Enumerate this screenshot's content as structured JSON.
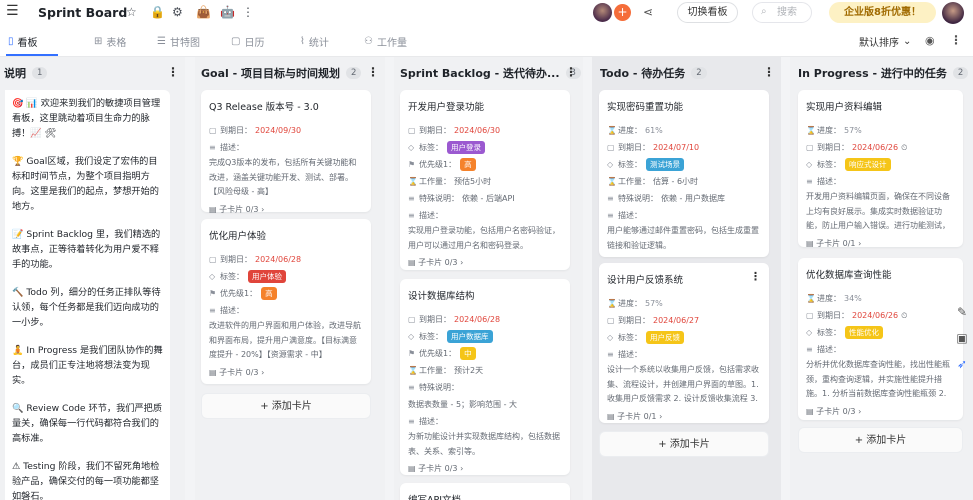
{
  "app": {
    "title": "Sprint Board",
    "switch_board": "切换看板",
    "search_placeholder": "搜索",
    "promo": "企业版8折优惠！"
  },
  "tabs": [
    {
      "label": "看板",
      "icon": "board-icon"
    },
    {
      "label": "表格",
      "icon": "table-icon"
    },
    {
      "label": "甘特图",
      "icon": "gantt-icon"
    },
    {
      "label": "日历",
      "icon": "calendar-icon"
    },
    {
      "label": "统计",
      "icon": "stats-icon"
    },
    {
      "label": "工作量",
      "icon": "workload-icon"
    }
  ],
  "sort_label": "默认排序",
  "columns": [
    {
      "title": "说明",
      "count": "1"
    },
    {
      "title": "Goal - 项目目标与时间规划",
      "count": "2"
    },
    {
      "title": "Sprint Backlog - 迭代待办...",
      "count": "3"
    },
    {
      "title": "Todo - 待办任务",
      "count": "2"
    },
    {
      "title": "In Progress - 进行中的任务",
      "count": "2"
    }
  ],
  "intro_paragraphs": [
    "🎯 📊 欢迎来到我们的敏捷项目管理看板，这里跳动着项目生命力的脉搏！📈 🛠",
    "🏆 Goal区域，我们设定了宏伟的目标和时间节点，为整个项目指明方向。这里是我们的起点，梦想开始的地方。",
    "📝 Sprint Backlog 里，我们精选的故事点，正等待着转化为用户爱不释手的功能。",
    "🔨 Todo 列，细分的任务正排队等待认领，每个任务都是我们迈向成功的一小步。",
    "🧘 In Progress 是我们团队协作的舞台，成员们正专注地将想法变为现实。",
    "🔍 Review Code 环节，我们严把质量关，确保每一行代码都符合我们的高标准。",
    "⚠ Testing 阶段，我们不留死角地检验产品，确保交付的每一项功能都坚如磐石。"
  ],
  "labels": {
    "due": "到期日：",
    "desc": "描述：",
    "tag": "标签：",
    "priority": "优先级1：",
    "workload": "工作量：",
    "special": "特殊说明：",
    "progress": "进度：",
    "add_card": "+ 添加卡片"
  },
  "goal_cards": [
    {
      "title": "Q3 Release 版本号 - 3.0",
      "due": "2024/09/30",
      "desc": "完成Q3版本的发布，包括所有关键功能和改进，涵盖关键功能开发、测试、部署。【风险母级 - 高】",
      "sub": "子卡片 0/3"
    },
    {
      "title": "优化用户体验",
      "due": "2024/06/28",
      "tag": "用户体验",
      "tag_color": "#e0453b",
      "priority": "高",
      "priority_color": "#f5822b",
      "desc": "改进软件的用户界面和用户体验，改进导航和界面布局，提升用户满意度。【目标满意度提升 - 20%】【资源需求 - 中】",
      "sub": "子卡片 0/3"
    }
  ],
  "backlog_cards": [
    {
      "title": "开发用户登录功能",
      "due": "2024/06/30",
      "tag": "用户登录",
      "tag_color": "#9b59d0",
      "priority": "高",
      "priority_color": "#f5822b",
      "workload": "预估5小时",
      "special": "依赖 - 后端API",
      "desc": "实现用户登录功能，包括用户名密码验证，用户可以通过用户名和密码登录。",
      "sub": "子卡片 0/3"
    },
    {
      "title": "设计数据库结构",
      "due": "2024/06/28",
      "tag": "用户数据库",
      "tag_color": "#3ba3d6",
      "priority": "中",
      "priority_color": "#f5c518",
      "workload": "预计2天",
      "special": "数据表数量 - 5；影响范围 - 大",
      "desc": "为新功能设计并实现数据库结构，包括数据表、关系、索引等。",
      "sub": "子卡片 0/3"
    },
    {
      "title": "编写API文档"
    }
  ],
  "todo_cards": [
    {
      "title": "实现密码重置功能",
      "progress": "61%",
      "due": "2024/07/10",
      "tag": "测试场景",
      "tag_color": "#3ba3d6",
      "workload": "估算 - 6小时",
      "special": "依赖 - 用户数据库",
      "desc": "用户能够通过邮件重置密码，包括生成重置链接和验证逻辑。"
    },
    {
      "title": "设计用户反馈系统",
      "progress": "57%",
      "due": "2024/06/27",
      "tag": "用户反馈",
      "tag_color": "#f5c518",
      "desc": "设计一个系统以收集用户反馈，包括需求收集、流程设计，并创建用户界面的草图。1. 收集用户反馈需求 2. 设计反馈收集流程 3. 创建",
      "sub": "子卡片 0/1"
    }
  ],
  "progress_cards": [
    {
      "title": "实现用户资料编辑",
      "progress": "57%",
      "due": "2024/06/26",
      "tag": "响应式设计",
      "tag_color": "#f5c518",
      "desc": "开发用户资料编辑页面，确保在不同设备上均有良好展示。集成实时数据验证功能，防止用户输入错误。进行功能测试，包括单",
      "sub": "子卡片 0/1"
    },
    {
      "title": "优化数据库查询性能",
      "progress": "34%",
      "due": "2024/06/26",
      "tag": "性能优化",
      "tag_color": "#f5c518",
      "desc": "分析并优化数据库查询性能，找出性能瓶颈，重构查询逻辑，并实施性能提升措施。1. 分析当前数据库查询性能瓶颈 2. 重构查询",
      "sub": "子卡片 0/3"
    }
  ]
}
